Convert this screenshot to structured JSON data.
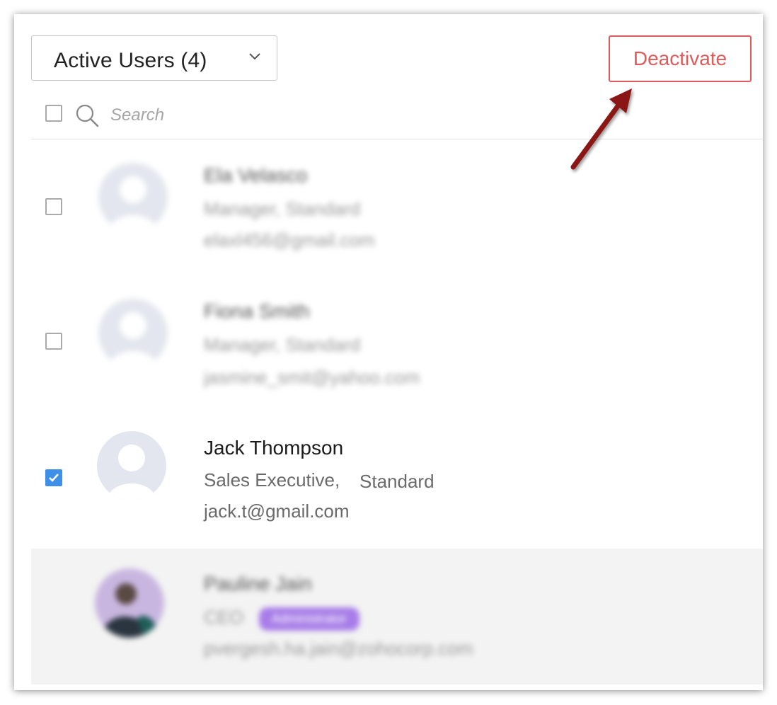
{
  "filter": {
    "label": "Active Users (4)"
  },
  "toolbar": {
    "deactivate_label": "Deactivate"
  },
  "search": {
    "placeholder": "Search"
  },
  "users": [
    {
      "name": "Ela Velasco",
      "role": "Manager, Standard",
      "email": "elaxl456@gmail.com",
      "checked": false,
      "blurred": true
    },
    {
      "name": "Fiona Smith",
      "role": "Manager, Standard",
      "email": "jasmine_smit@yahoo.com",
      "checked": false,
      "blurred": true
    },
    {
      "name": "Jack Thompson",
      "role": "Sales Executive,",
      "profile": "Standard",
      "email": "jack.t@gmail.com",
      "checked": true,
      "blurred": false
    },
    {
      "name": "Pauline Jain",
      "role": "CEO",
      "profile": "Administrator",
      "email": "pvergesh.ha.jain@zohocorp.com",
      "checked": false,
      "blurred": true
    }
  ],
  "colors": {
    "accent_red": "#df5a5a",
    "check_blue": "#3d8fe8",
    "arrow": "#8b1414",
    "badge_purple": "#a77ce8"
  },
  "icons": {
    "dropdown": "chevron-down-icon",
    "search": "search-icon",
    "avatar": "user-avatar-icon",
    "check": "checkmark-icon"
  }
}
